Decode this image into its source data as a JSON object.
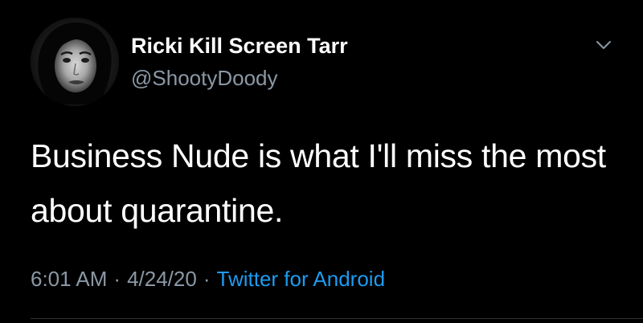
{
  "user": {
    "display_name": "Ricki Kill Screen Tarr",
    "handle": "@ShootyDoody",
    "avatar_icon": "profile-photo"
  },
  "tweet": {
    "text": "Business Nude is what I'll miss the most about quarantine.",
    "time": "6:01 AM",
    "date": "4/24/20",
    "separator": "·",
    "source": "Twitter for Android"
  },
  "menu": {
    "icon": "chevron-down-icon"
  },
  "colors": {
    "background": "#000000",
    "name": "#ffffff",
    "secondary": "#8b98a5",
    "link": "#1d9bf0"
  }
}
